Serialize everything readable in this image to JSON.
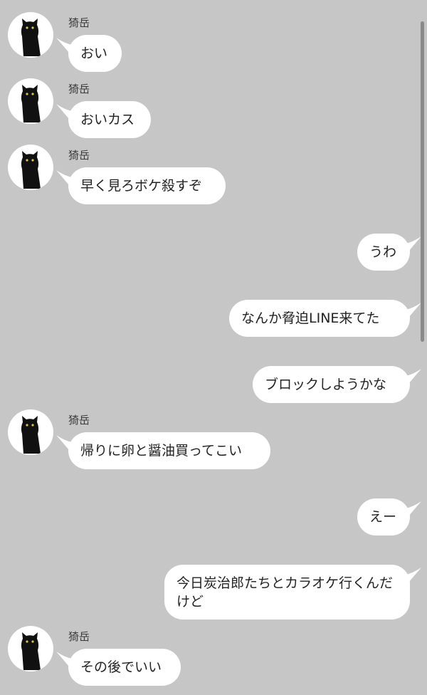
{
  "conversation": {
    "messages": [
      {
        "side": "left",
        "sender": "猗岳",
        "text": "おい"
      },
      {
        "side": "left",
        "sender": "猗岳",
        "text": "おいカス"
      },
      {
        "side": "left",
        "sender": "猗岳",
        "text": "早く見ろボケ殺すぞ"
      },
      {
        "side": "right",
        "text": "うわ"
      },
      {
        "side": "right",
        "text": "なんか脅迫LINE来てた"
      },
      {
        "side": "right",
        "text": "ブロックしようかな"
      },
      {
        "side": "left",
        "sender": "猗岳",
        "text": "帰りに卵と醤油買ってこい"
      },
      {
        "side": "right",
        "text": "えー"
      },
      {
        "side": "right",
        "text": "今日炭治郎たちとカラオケ行くんだけど"
      },
      {
        "side": "left",
        "sender": "猗岳",
        "text": "その後でいい"
      }
    ]
  },
  "colors": {
    "background": "#c6c6c6",
    "bubble": "#ffffff",
    "avatar_cat": "black-cat-icon"
  }
}
